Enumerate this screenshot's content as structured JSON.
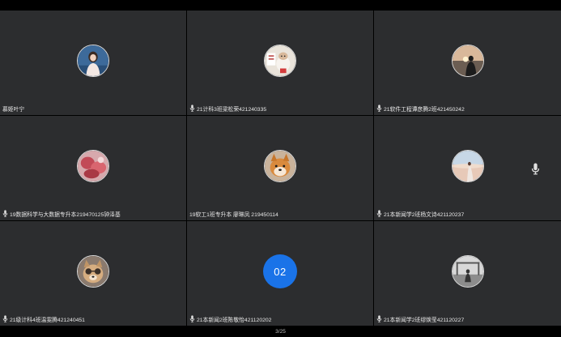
{
  "participants": [
    {
      "name": "慕姬叶宁",
      "mic": false
    },
    {
      "name": "21计科3班梁松荣421240335",
      "mic": true
    },
    {
      "name": "21软件工程谭彦腾2班421450242",
      "mic": true
    },
    {
      "name": "19数据科学与大数据专升本219470125钟泽基",
      "mic": true
    },
    {
      "name": "19软工1班专升本 廖琳凤 219450114",
      "mic": false
    },
    {
      "name": "21本新闻学2班杨文诗421120237",
      "mic": true
    },
    {
      "name": "21级计科4班温雯腾421240451",
      "mic": true
    },
    {
      "name": "21本新闻2班陈敬怡421120202",
      "mic": true,
      "badge": "02"
    },
    {
      "name": "21本新闻学2班缪焕莹421120227",
      "mic": true
    }
  ],
  "page_indicator": "3/25",
  "colors": {
    "tile_bg": "#2c2d2f",
    "badge_bg": "#1a73e8",
    "screen_bg": "#000000"
  }
}
